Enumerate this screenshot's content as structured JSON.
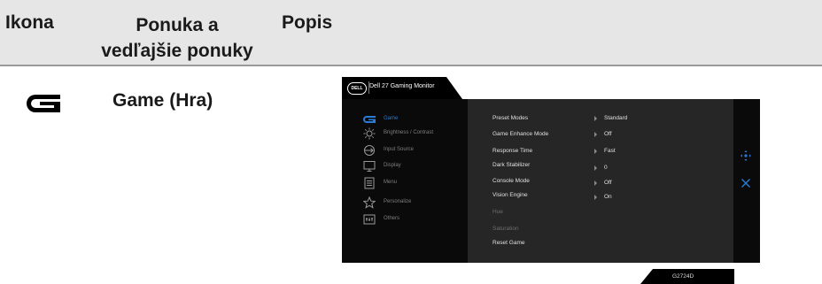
{
  "table": {
    "headers": {
      "icon": "Ikona",
      "menu_line1": "Ponuka a",
      "menu_line2": "vedľajšie ponuky",
      "description": "Popis"
    },
    "row": {
      "icon": "game-icon",
      "title": "Game (Hra)"
    }
  },
  "osd": {
    "title": "Dell 27 Gaming Monitor",
    "logo_text": "DELL",
    "accent_color": "#2a7bd5",
    "nav_items": [
      {
        "label": "Game",
        "icon": "game-icon",
        "active": true
      },
      {
        "label": "Brightness / Contrast",
        "icon": "brightness-icon",
        "active": false
      },
      {
        "label": "Input Source",
        "icon": "input-source-icon",
        "active": false
      },
      {
        "label": "Display",
        "icon": "display-icon",
        "active": false
      },
      {
        "label": "Menu",
        "icon": "menu-icon",
        "active": false
      },
      {
        "label": "Personalize",
        "icon": "star-icon",
        "active": false
      },
      {
        "label": "Others",
        "icon": "others-icon",
        "active": false
      }
    ],
    "settings": [
      {
        "label": "Preset Modes",
        "value": "Standard"
      },
      {
        "label": "Game Enhance Mode",
        "value": "Off"
      },
      {
        "label": "Response Time",
        "value": "Fast"
      },
      {
        "label": "Dark Stabilizer",
        "value": "0"
      },
      {
        "label": "Console Mode",
        "value": "Off"
      },
      {
        "label": "Vision Engine",
        "value": "On"
      },
      {
        "label": "Hue",
        "value": ""
      },
      {
        "label": "Saturation",
        "value": ""
      },
      {
        "label": "Reset Game",
        "value": ""
      }
    ],
    "side_icons": [
      "move-icon",
      "close-icon"
    ],
    "model": "G2724D"
  }
}
